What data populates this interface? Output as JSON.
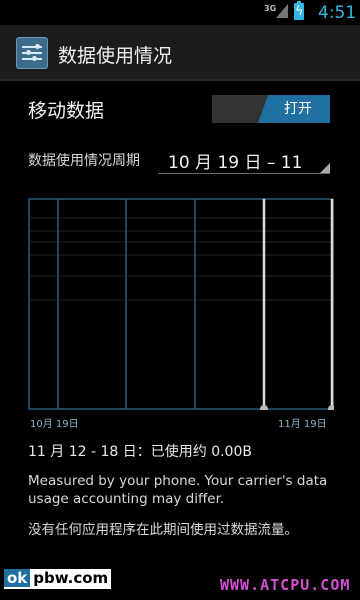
{
  "status_bar": {
    "network": "3G",
    "time": "4:51"
  },
  "action_bar": {
    "title": "数据使用情况",
    "icon": "data-usage-icon"
  },
  "mobile_data": {
    "label": "移动数据",
    "toggle_state": "打开"
  },
  "cycle": {
    "label": "数据使用情况周期",
    "value": "10 月 19 日 – 11"
  },
  "chart": {
    "left_date": "10月 19日",
    "right_date": "11月 19日"
  },
  "usage_summary": "11 月 12 - 18 日：已使用约 0.00B",
  "disclaimer": "Measured by your phone. Your carrier's data usage accounting may differ.",
  "no_apps_message": "没有任何应用程序在此期间使用过数据流量。",
  "watermarks": {
    "left_ok": "ok",
    "left_rest": "pbw.com",
    "right": "WWW.ATCPU.COM"
  },
  "colors": {
    "accent": "#33b5e5",
    "toggle_on": "#1f6fa0"
  }
}
